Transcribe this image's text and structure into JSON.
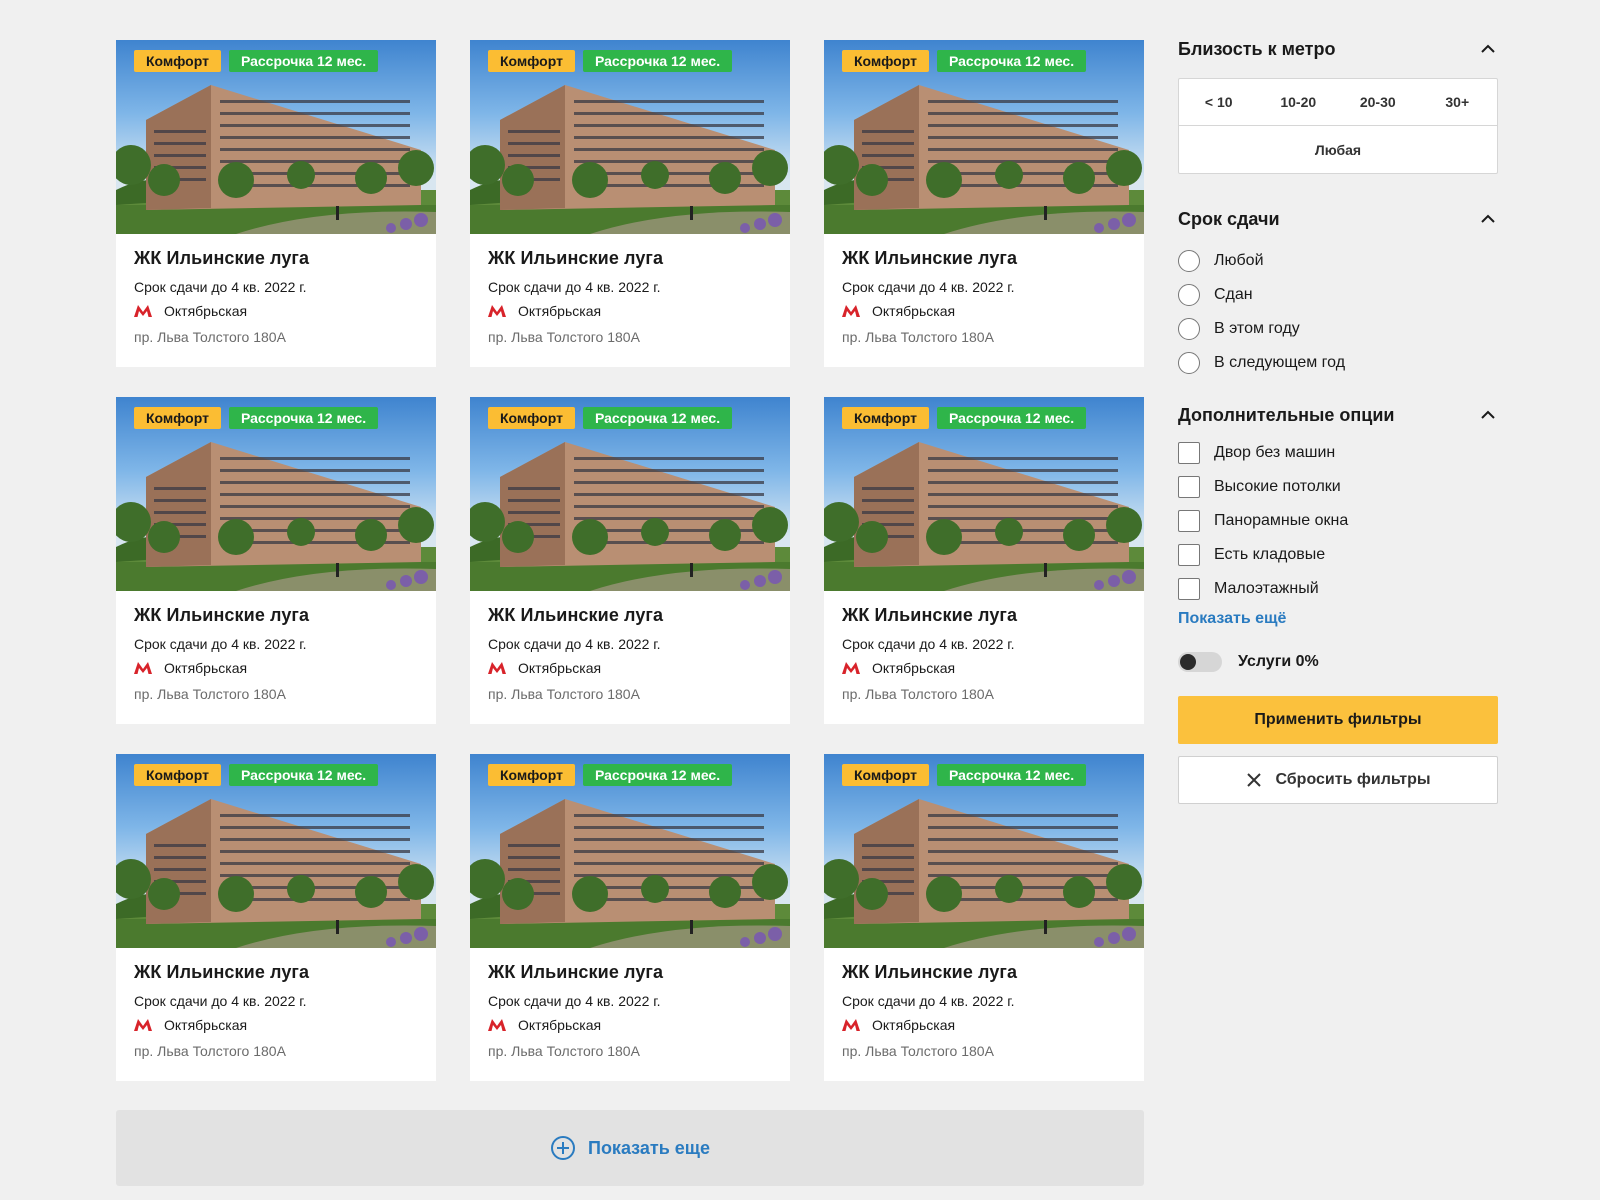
{
  "listings": [
    {
      "badge_class": "Комфорт",
      "badge_installment": "Рассрочка 12 мес.",
      "title": "ЖК Ильинские луга",
      "term": "Срок сдачи до 4 кв. 2022 г.",
      "metro": "Октябрьская",
      "address": "пр. Льва Толстого 180А"
    },
    {
      "badge_class": "Комфорт",
      "badge_installment": "Рассрочка 12 мес.",
      "title": "ЖК Ильинские луга",
      "term": "Срок сдачи до 4 кв. 2022 г.",
      "metro": "Октябрьская",
      "address": "пр. Льва Толстого 180А"
    },
    {
      "badge_class": "Комфорт",
      "badge_installment": "Рассрочка 12 мес.",
      "title": "ЖК Ильинские луга",
      "term": "Срок сдачи до 4 кв. 2022 г.",
      "metro": "Октябрьская",
      "address": "пр. Льва Толстого 180А"
    },
    {
      "badge_class": "Комфорт",
      "badge_installment": "Рассрочка 12 мес.",
      "title": "ЖК Ильинские луга",
      "term": "Срок сдачи до 4 кв. 2022 г.",
      "metro": "Октябрьская",
      "address": "пр. Льва Толстого 180А"
    },
    {
      "badge_class": "Комфорт",
      "badge_installment": "Рассрочка 12 мес.",
      "title": "ЖК Ильинские луга",
      "term": "Срок сдачи до 4 кв. 2022 г.",
      "metro": "Октябрьская",
      "address": "пр. Льва Толстого 180А"
    },
    {
      "badge_class": "Комфорт",
      "badge_installment": "Рассрочка 12 мес.",
      "title": "ЖК Ильинские луга",
      "term": "Срок сдачи до 4 кв. 2022 г.",
      "metro": "Октябрьская",
      "address": "пр. Льва Толстого 180А"
    },
    {
      "badge_class": "Комфорт",
      "badge_installment": "Рассрочка 12 мес.",
      "title": "ЖК Ильинские луга",
      "term": "Срок сдачи до 4 кв. 2022 г.",
      "metro": "Октябрьская",
      "address": "пр. Льва Толстого 180А"
    },
    {
      "badge_class": "Комфорт",
      "badge_installment": "Рассрочка 12 мес.",
      "title": "ЖК Ильинские луга",
      "term": "Срок сдачи до 4 кв. 2022 г.",
      "metro": "Октябрьская",
      "address": "пр. Льва Толстого 180А"
    },
    {
      "badge_class": "Комфорт",
      "badge_installment": "Рассрочка 12 мес.",
      "title": "ЖК Ильинские луга",
      "term": "Срок сдачи до 4 кв. 2022 г.",
      "metro": "Октябрьская",
      "address": "пр. Льва Толстого 180А"
    }
  ],
  "show_more_label": "Показать еще",
  "filters": {
    "metro_proximity": {
      "title": "Близость к метро",
      "options": [
        "< 10",
        "10-20",
        "20-30",
        "30+"
      ],
      "any_label": "Любая"
    },
    "deadline": {
      "title": "Срок сдачи",
      "options": [
        "Любой",
        "Сдан",
        "В этом году",
        "В следующем год"
      ]
    },
    "extra": {
      "title": "Дополнительные опции",
      "options": [
        "Двор без машин",
        "Высокие потолки",
        "Панорамные окна",
        "Есть кладовые",
        "Малоэтажный"
      ],
      "show_more_link": "Показать ещё"
    },
    "services_toggle_label": "Услуги 0%",
    "services_toggle_on": false,
    "apply_label": "Применить фильтры",
    "reset_label": "Сбросить фильтры"
  },
  "icons": {
    "metro": "metro-m-icon",
    "chevron": "chevron-up-icon",
    "plus": "plus-circle-icon",
    "close": "close-icon"
  },
  "colors": {
    "accent_yellow": "#fbc13d",
    "badge_green": "#2fb54a",
    "link_blue": "#2a7bc0",
    "metro_red": "#d8232a"
  }
}
